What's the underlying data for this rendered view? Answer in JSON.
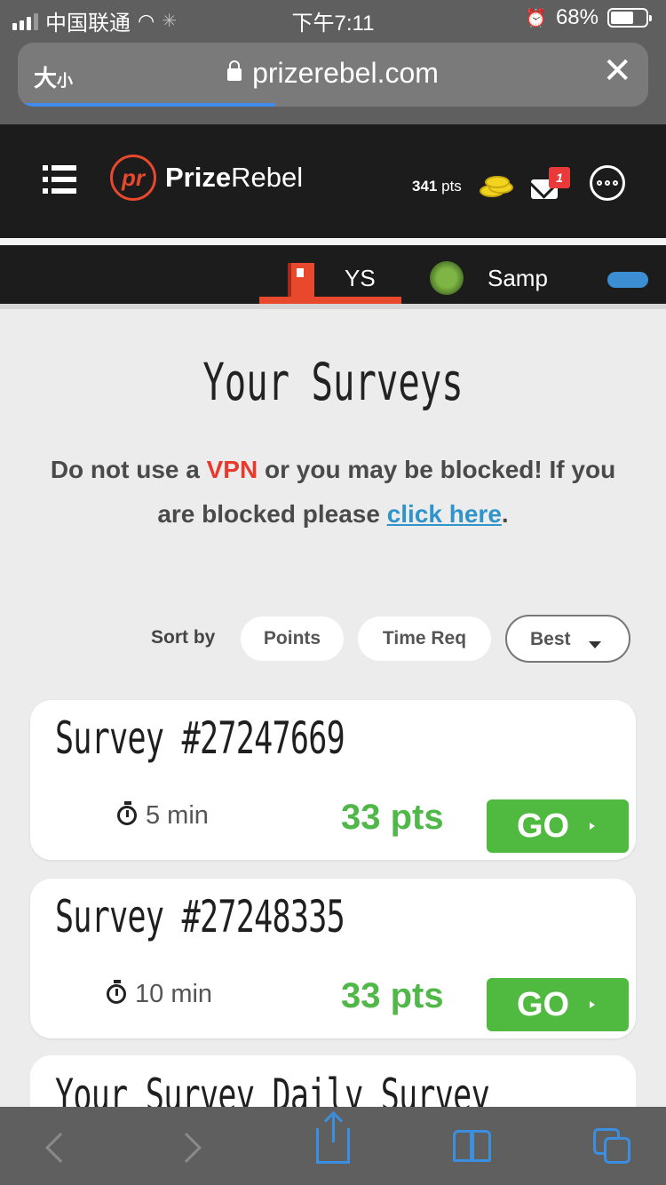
{
  "status": {
    "carrier": "中国联通",
    "time": "下午7:11",
    "battery_percent": "68%",
    "battery_level": 0.68
  },
  "browser": {
    "text_size_label_big": "大",
    "text_size_label_small": "小",
    "url": "prizerebel.com",
    "close_icon": "✕",
    "load_progress": 0.4
  },
  "header": {
    "logo_mark": "pr",
    "logo_prize": "Prize",
    "logo_rebel": "Rebel",
    "points_value": "341",
    "points_unit": "pts",
    "mail_badge": "1"
  },
  "tabs": [
    {
      "label": "YS",
      "active": true
    },
    {
      "label": "Samp",
      "active": false
    }
  ],
  "main": {
    "title": "Your Surveys",
    "notice_pre": "Do not use a ",
    "notice_vpn": "VPN",
    "notice_mid": " or you may be blocked! If you are blocked please ",
    "notice_link": "click here",
    "notice_end": "."
  },
  "sort": {
    "label": "Sort by",
    "options": [
      "Points",
      "Time Req"
    ],
    "selected": "Best"
  },
  "surveys": [
    {
      "title": "Survey #27247669",
      "time": "5 min",
      "points": "33 pts",
      "go": "GO"
    },
    {
      "title": "Survey #27248335",
      "time": "10 min",
      "points": "33 pts",
      "go": "GO"
    },
    {
      "title": "Your Survey Daily Survey"
    }
  ],
  "colors": {
    "brand_red": "#e8492c",
    "green": "#4fba3f",
    "link_blue": "#2f94c9",
    "header_bg": "#1c1c1c"
  }
}
